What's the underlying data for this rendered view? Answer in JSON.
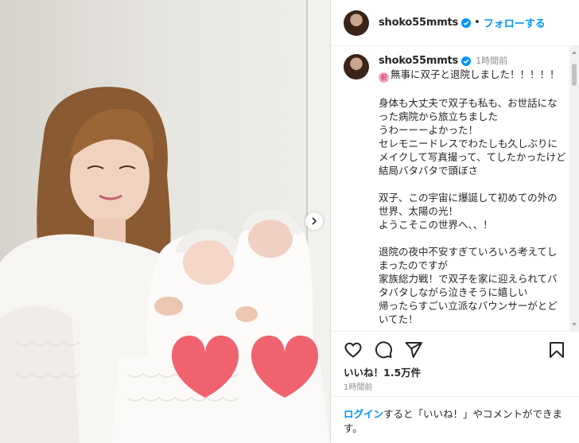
{
  "post": {
    "username": "shoko55mmts",
    "follow_separator": "•",
    "follow_label": "フォローする",
    "time_ago": "1時間前",
    "caption_lines": [
      "無事に双子と退院しました！！！！！",
      "",
      "身体も大丈夫で双子も私も、お世話になった病院から旅立ちました",
      "うわーーーよかった！",
      "セレモニードレスでわたしも久しぶりにメイクして写真撮って、てしたかったけど結局バタバタで頭ぼさ",
      "",
      "双子、この宇宙に爆誕して初めての外の世界、太陽の光！",
      "ようこそこの世界へ、、！",
      "",
      "退院の夜中不安すぎていろいろ考えてしまったのですが",
      "家族総力戦！で双子を家に迎えられてバタバタしながら泣きそうに嬉しい",
      "帰ったらすごい立派なバウンサーがとどいてた！"
    ],
    "emoji_glyph": "祝",
    "likes": "いいね！1.5万件",
    "posted_time": "1時間前",
    "login_link": "ログイン",
    "login_rest": "すると「いいね！」やコメントができます。"
  },
  "icons": {
    "verified": "verified-badge-icon",
    "like": "heart-outline-icon",
    "comment": "comment-bubble-icon",
    "share": "paper-plane-icon",
    "save": "bookmark-icon",
    "next": "chevron-right-icon"
  },
  "colors": {
    "link_blue": "#0095f6",
    "dark_link": "#00376b",
    "muted": "#8e8e8e",
    "heart_sticker": "#f1626f"
  }
}
